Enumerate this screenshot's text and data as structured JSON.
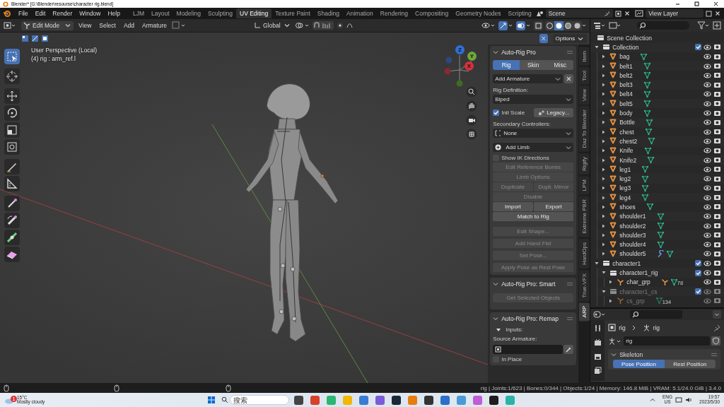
{
  "title_bar": {
    "title": "Blender* [G:\\Blender\\resourse\\character rig.blend]"
  },
  "menu": [
    "File",
    "Edit",
    "Render",
    "Window",
    "Help"
  ],
  "workspaces": [
    {
      "label": "LJM",
      "selected": false
    },
    {
      "label": "Layout",
      "selected": false
    },
    {
      "label": "Modeling",
      "selected": false
    },
    {
      "label": "Sculpting",
      "selected": false
    },
    {
      "label": "UV Editing",
      "selected": true
    },
    {
      "label": "Texture Paint",
      "selected": false
    },
    {
      "label": "Shading",
      "selected": false
    },
    {
      "label": "Animation",
      "selected": false
    },
    {
      "label": "Rendering",
      "selected": false
    },
    {
      "label": "Compositing",
      "selected": false
    },
    {
      "label": "Geometry Nodes",
      "selected": false
    },
    {
      "label": "Scripting",
      "selected": false
    }
  ],
  "scene": "Scene",
  "view_layer": "View Layer",
  "viewport_header": {
    "mode": "Edit Mode",
    "menus": [
      "View",
      "Select",
      "Add",
      "Armature"
    ],
    "orientation": "Global",
    "x_mirror": {
      "label": "X",
      "on": true
    },
    "options": "Options"
  },
  "viewport": {
    "perspective": "User Perspective (Local)",
    "object": "(4) rig : arm_ref.l",
    "gizmo": [
      {
        "label": "Z",
        "color": "#2f6fd6"
      },
      {
        "label": "Y",
        "color": "#6ea83a"
      },
      {
        "label": "X",
        "color": "#d8303c"
      }
    ],
    "tools": [
      {
        "kind": "select",
        "selected": true
      },
      {
        "kind": "cursor",
        "selected": false
      },
      {
        "kind": "move",
        "selected": false
      },
      {
        "kind": "rotate",
        "selected": false
      },
      {
        "kind": "scale",
        "selected": false
      },
      {
        "kind": "transform",
        "selected": false
      },
      {
        "kind": "annotate",
        "selected": false
      },
      {
        "kind": "measure",
        "selected": false
      },
      {
        "kind": "extrude",
        "selected": false
      },
      {
        "kind": "roll",
        "selected": false
      },
      {
        "kind": "envelope",
        "selected": false
      },
      {
        "kind": "eraser",
        "selected": false
      }
    ]
  },
  "sidebar": {
    "tabs": [
      {
        "label": "Item",
        "selected": false
      },
      {
        "label": "Tool",
        "selected": false
      },
      {
        "label": "View",
        "selected": false
      },
      {
        "label": "Daz To Blender",
        "selected": false
      },
      {
        "label": "Rigify",
        "selected": false
      },
      {
        "label": "LPM",
        "selected": false
      },
      {
        "label": "Extreme PBR",
        "selected": false
      },
      {
        "label": "HardOps",
        "selected": false
      },
      {
        "label": "True-VFX",
        "selected": false
      },
      {
        "label": "ARP",
        "selected": true
      }
    ],
    "arp": {
      "title": "Auto-Rig Pro",
      "tabs": [
        {
          "label": "Rig",
          "selected": true
        },
        {
          "label": "Skin",
          "selected": false
        },
        {
          "label": "Misc",
          "selected": false
        }
      ],
      "add_armature": "Add Armature",
      "rig_definition_label": "Rig Definition:",
      "rig_definition": "Biped",
      "init_scale": {
        "label": "Init Scale",
        "checked": true
      },
      "legacy": "Legacy...",
      "secondary_label": "Secondary Controllers:",
      "secondary": "None",
      "add_limb": "Add Limb",
      "show_ik": {
        "label": "Show IK Directions",
        "checked": false
      },
      "rows": [
        [
          {
            "label": "Edit Reference Bones",
            "disabled": true
          }
        ],
        [
          {
            "label": "Limb Options",
            "disabled": true
          }
        ],
        [
          {
            "label": "Duplicate",
            "disabled": true
          },
          {
            "label": "Dupli. Mirror",
            "disabled": true
          }
        ],
        [
          {
            "label": "Disable",
            "disabled": true
          }
        ],
        [
          {
            "label": "Import",
            "disabled": false
          },
          {
            "label": "Export",
            "disabled": false
          }
        ],
        [
          {
            "label": "Match to Rig",
            "disabled": false
          }
        ]
      ],
      "extra_rows": [
        [
          {
            "label": "Edit Shape...",
            "disabled": true
          }
        ],
        [
          {
            "label": "Add Hand Fist",
            "disabled": true
          }
        ],
        [
          {
            "label": "Set Pose...",
            "disabled": true
          }
        ],
        [
          {
            "label": "Apply Pose as Rest Pose",
            "disabled": true
          }
        ]
      ]
    },
    "smart": {
      "title": "Auto-Rig Pro: Smart",
      "button": {
        "label": "Get Selected Objects",
        "disabled": true
      }
    },
    "remap": {
      "title": "Auto-Rig Pro: Remap",
      "inputs": "Inputs:",
      "source_label": "Source Armature:",
      "in_place": {
        "label": "In Place",
        "checked": false
      }
    }
  },
  "outliner": {
    "root": "Scene Collection",
    "tree": [
      {
        "label": "Collection",
        "kind": "collection",
        "expanded": true,
        "checked": true,
        "disabled": false,
        "children": [
          {
            "label": "bag",
            "kind": "mesh",
            "expanded": false,
            "disabled": false,
            "extras": [
              {
                "kind": "mesh"
              }
            ]
          },
          {
            "label": "belt1",
            "kind": "mesh",
            "expanded": false,
            "disabled": false,
            "extras": [
              {
                "kind": "mesh"
              }
            ]
          },
          {
            "label": "belt2",
            "kind": "mesh",
            "expanded": false,
            "disabled": false,
            "extras": [
              {
                "kind": "mesh"
              }
            ]
          },
          {
            "label": "belt3",
            "kind": "mesh",
            "expanded": false,
            "disabled": false,
            "extras": [
              {
                "kind": "mesh"
              }
            ]
          },
          {
            "label": "belt4",
            "kind": "mesh",
            "expanded": false,
            "disabled": false,
            "extras": [
              {
                "kind": "mesh"
              }
            ]
          },
          {
            "label": "belt5",
            "kind": "mesh",
            "expanded": false,
            "disabled": false,
            "extras": [
              {
                "kind": "mesh"
              }
            ]
          },
          {
            "label": "body",
            "kind": "mesh",
            "expanded": false,
            "disabled": false,
            "extras": [
              {
                "kind": "mesh"
              }
            ]
          },
          {
            "label": "Bottle",
            "kind": "mesh",
            "expanded": false,
            "disabled": false,
            "extras": [
              {
                "kind": "mesh"
              }
            ]
          },
          {
            "label": "chest",
            "kind": "mesh",
            "expanded": false,
            "disabled": false,
            "extras": [
              {
                "kind": "mesh"
              }
            ]
          },
          {
            "label": "chest2",
            "kind": "mesh",
            "expanded": false,
            "disabled": false,
            "extras": [
              {
                "kind": "mesh"
              }
            ]
          },
          {
            "label": "Knife",
            "kind": "mesh",
            "expanded": false,
            "disabled": false,
            "extras": [
              {
                "kind": "mesh"
              }
            ]
          },
          {
            "label": "Knife2",
            "kind": "mesh",
            "expanded": false,
            "disabled": false,
            "extras": [
              {
                "kind": "mesh"
              }
            ]
          },
          {
            "label": "leg1",
            "kind": "mesh",
            "expanded": false,
            "disabled": false,
            "extras": [
              {
                "kind": "mesh"
              }
            ]
          },
          {
            "label": "leg2",
            "kind": "mesh",
            "expanded": false,
            "disabled": false,
            "extras": [
              {
                "kind": "mesh"
              }
            ]
          },
          {
            "label": "leg3",
            "kind": "mesh",
            "expanded": false,
            "disabled": false,
            "extras": [
              {
                "kind": "mesh"
              }
            ]
          },
          {
            "label": "leg4",
            "kind": "mesh",
            "expanded": false,
            "disabled": false,
            "extras": [
              {
                "kind": "mesh"
              }
            ]
          },
          {
            "label": "shoes",
            "kind": "mesh",
            "expanded": false,
            "disabled": false,
            "extras": [
              {
                "kind": "mesh"
              }
            ]
          },
          {
            "label": "shoulder1",
            "kind": "mesh",
            "expanded": false,
            "disabled": false,
            "extras": [
              {
                "kind": "mesh"
              }
            ]
          },
          {
            "label": "shoulder2",
            "kind": "mesh",
            "expanded": false,
            "disabled": false,
            "extras": [
              {
                "kind": "mesh"
              }
            ]
          },
          {
            "label": "shoulder3",
            "kind": "mesh",
            "expanded": false,
            "disabled": false,
            "extras": [
              {
                "kind": "mesh"
              }
            ]
          },
          {
            "label": "shoulder4",
            "kind": "mesh",
            "expanded": false,
            "disabled": false,
            "extras": [
              {
                "kind": "mesh"
              }
            ]
          },
          {
            "label": "shoulder5",
            "kind": "mesh",
            "expanded": false,
            "disabled": false,
            "extras": [
              {
                "kind": "modifier"
              },
              {
                "kind": "mesh"
              }
            ]
          }
        ]
      },
      {
        "label": "character1",
        "kind": "collection",
        "expanded": true,
        "checked": true,
        "disabled": false,
        "children": [
          {
            "label": "character1_rig",
            "kind": "collection",
            "expanded": true,
            "checked": true,
            "disabled": false,
            "children": [
              {
                "label": "char_grp",
                "kind": "armature",
                "expanded": false,
                "disabled": false,
                "extras": [
                  {
                    "kind": "armature"
                  },
                  {
                    "kind": "mesh",
                    "count": "78"
                  }
                ]
              }
            ]
          },
          {
            "label": "character1_cs",
            "kind": "collection",
            "expanded": true,
            "checked": true,
            "disabled": true,
            "children": [
              {
                "label": "cs_grp",
                "kind": "armature",
                "expanded": false,
                "disabled": true,
                "extras": [
                  {
                    "kind": "mesh",
                    "count": "134"
                  }
                ]
              }
            ]
          }
        ]
      }
    ]
  },
  "properties": {
    "breadcrumb": [
      "rig",
      "rig"
    ],
    "name": "rig",
    "panel": "Skeleton",
    "positions": [
      {
        "label": "Pose Position",
        "selected": true
      },
      {
        "label": "Rest Position",
        "selected": false
      }
    ]
  },
  "status_bar": {
    "stats": "rig | Joints:1/623 | Bones:0/344 | Objects:1/24 | Memory: 146.8 MiB | VRAM: 5.1/24.0 GiB | 3.4.0"
  },
  "taskbar": {
    "weather_badge": "1",
    "temperature": "15°C",
    "weather": "Mostly cloudy",
    "search": {
      "placeholder": "搜索"
    },
    "language": "ENG",
    "region": "US",
    "time": "19:57",
    "date": "2023/5/30"
  }
}
